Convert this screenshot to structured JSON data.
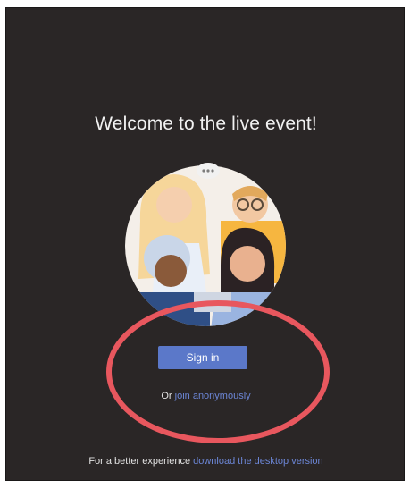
{
  "page": {
    "title": "Welcome to the live event!"
  },
  "illustration": {
    "icon": "people-group-illustration"
  },
  "actions": {
    "sign_in_label": "Sign in",
    "or_prefix": "Or",
    "join_anonymously_label": "join anonymously"
  },
  "footer": {
    "prefix": "For a better experience",
    "link_label": "download the desktop version"
  },
  "colors": {
    "background": "#2a2626",
    "accent": "#5b78c9",
    "link": "#6c86d6",
    "annotation": "#e8575e"
  }
}
